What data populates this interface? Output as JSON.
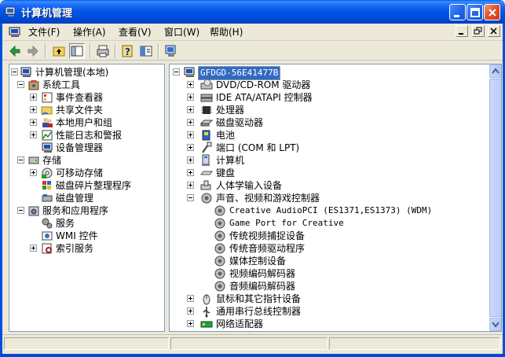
{
  "window": {
    "title": "计算机管理"
  },
  "menu": [
    {
      "label": "文件(F)"
    },
    {
      "label": "操作(A)"
    },
    {
      "label": "查看(V)"
    },
    {
      "label": "窗口(W)"
    },
    {
      "label": "帮助(H)"
    }
  ],
  "left_tree": {
    "root": "计算机管理(本地)",
    "system_tools": "系统工具",
    "event_viewer": "事件查看器",
    "shared_folders": "共享文件夹",
    "local_users": "本地用户和组",
    "perf_logs": "性能日志和警报",
    "device_manager": "设备管理器",
    "storage": "存储",
    "removable": "可移动存储",
    "defrag": "磁盘碎片整理程序",
    "disk_mgmt": "磁盘管理",
    "services_apps": "服务和应用程序",
    "services": "服务",
    "wmi": "WMI 控件",
    "indexing": "索引服务"
  },
  "right_tree": {
    "computer": "GFDGD-56E41477B",
    "dvd": "DVD/CD-ROM 驱动器",
    "ide": "IDE ATA/ATAPI 控制器",
    "cpu": "处理器",
    "disk": "磁盘驱动器",
    "battery": "电池",
    "ports": "端口 (COM 和 LPT)",
    "computer_node": "计算机",
    "keyboard": "键盘",
    "hid": "人体学输入设备",
    "sound": "声音、视频和游戏控制器",
    "sound_children": [
      "Creative AudioPCI (ES1371,ES1373) (WDM)",
      "Game Port for Creative",
      "传统视频捕捉设备",
      "传统音频驱动程序",
      "媒体控制设备",
      "视频编码解码器",
      "音频编码解码器"
    ],
    "mouse": "鼠标和其它指针设备",
    "usb": "通用串行总线控制器",
    "network": "网络适配器"
  }
}
